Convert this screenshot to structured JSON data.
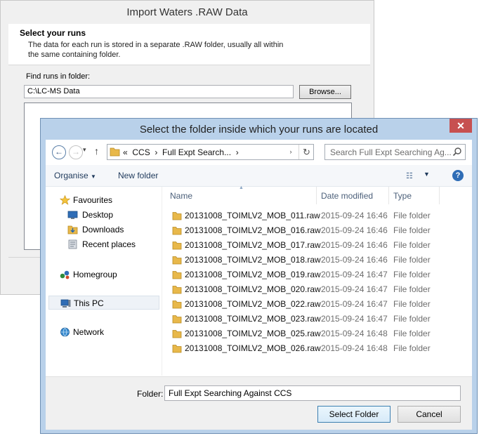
{
  "background_window": {
    "title": "Import Waters .RAW Data",
    "section_heading": "Select your runs",
    "section_description": "The data for each run is stored in a separate .RAW folder, usually all within the same containing folder.",
    "find_label": "Find runs in folder:",
    "folder_value": "C:\\LC-MS Data",
    "browse_label": "Browse..."
  },
  "dialog": {
    "title": "Select the folder inside which your runs are located",
    "close_glyph": "✕",
    "nav": {
      "back_glyph": "←",
      "forward_glyph": "→",
      "dropdown_glyph": "▾",
      "up_glyph": "↑",
      "breadcrumb_overflow": "«",
      "breadcrumb_1": "CCS",
      "breadcrumb_sep": "›",
      "breadcrumb_2": "Full Expt Search...",
      "address_dropdown_glyph": "›",
      "refresh_glyph": "↻",
      "search_placeholder": "Search Full Expt Searching Ag..."
    },
    "commands": {
      "organise_label": "Organise",
      "organise_arrow": "▼",
      "new_folder_label": "New folder",
      "view_glyph": "☷",
      "view_arrow": "▼",
      "help_glyph": "?"
    },
    "nav_pane": {
      "favourites": "Favourites",
      "desktop": "Desktop",
      "downloads": "Downloads",
      "recent_places": "Recent places",
      "homegroup": "Homegroup",
      "this_pc": "This PC",
      "network": "Network"
    },
    "columns": {
      "name": "Name",
      "date_modified": "Date modified",
      "type": "Type",
      "sort_glyph": "▲"
    },
    "files": [
      {
        "name": "20131008_TOIMLV2_MOB_011.raw",
        "date": "2015-09-24 16:46",
        "type": "File folder"
      },
      {
        "name": "20131008_TOIMLV2_MOB_016.raw",
        "date": "2015-09-24 16:46",
        "type": "File folder"
      },
      {
        "name": "20131008_TOIMLV2_MOB_017.raw",
        "date": "2015-09-24 16:46",
        "type": "File folder"
      },
      {
        "name": "20131008_TOIMLV2_MOB_018.raw",
        "date": "2015-09-24 16:46",
        "type": "File folder"
      },
      {
        "name": "20131008_TOIMLV2_MOB_019.raw",
        "date": "2015-09-24 16:47",
        "type": "File folder"
      },
      {
        "name": "20131008_TOIMLV2_MOB_020.raw",
        "date": "2015-09-24 16:47",
        "type": "File folder"
      },
      {
        "name": "20131008_TOIMLV2_MOB_022.raw",
        "date": "2015-09-24 16:47",
        "type": "File folder"
      },
      {
        "name": "20131008_TOIMLV2_MOB_023.raw",
        "date": "2015-09-24 16:47",
        "type": "File folder"
      },
      {
        "name": "20131008_TOIMLV2_MOB_025.raw",
        "date": "2015-09-24 16:48",
        "type": "File folder"
      },
      {
        "name": "20131008_TOIMLV2_MOB_026.raw",
        "date": "2015-09-24 16:48",
        "type": "File folder"
      }
    ],
    "footer": {
      "folder_label": "Folder:",
      "folder_value": "Full Expt Searching Against CCS",
      "select_button": "Select Folder",
      "cancel_button": "Cancel"
    }
  },
  "colors": {
    "dialog_frame": "#b9d1ea",
    "close_button": "#c75050",
    "folder_icon": "#e8b84a",
    "link_text": "#1e395b"
  }
}
